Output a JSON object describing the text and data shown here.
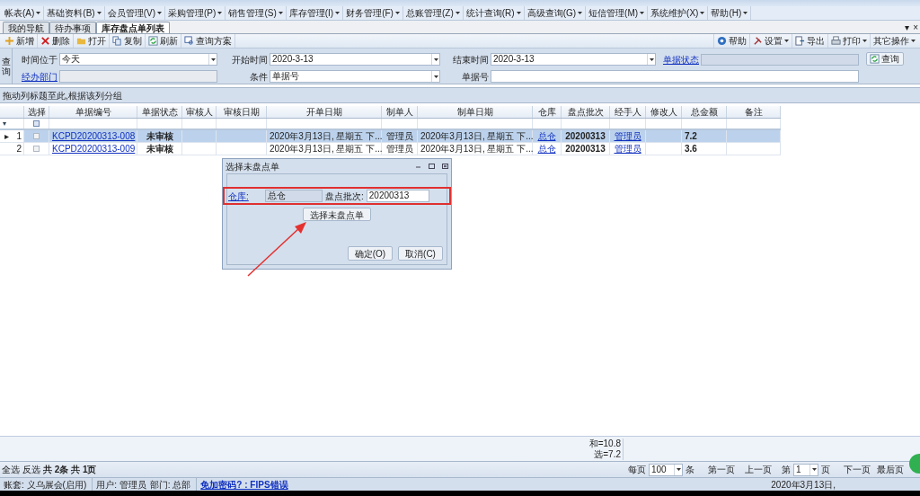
{
  "menu": [
    "帐表(A)",
    "基础资料(B)",
    "会员管理(V)",
    "采购管理(P)",
    "销售管理(S)",
    "库存管理(I)",
    "财务管理(F)",
    "总账管理(Z)",
    "统计查询(R)",
    "高级查询(G)",
    "短信管理(M)",
    "系统维护(X)",
    "帮助(H)"
  ],
  "doc_tabs": [
    {
      "label": "我的导航",
      "selected": false
    },
    {
      "label": "待办事项",
      "selected": false
    },
    {
      "label": "库存盘点单列表",
      "selected": true
    }
  ],
  "tab_controls": [
    "▾",
    "×"
  ],
  "toolbar_left": [
    "新增",
    "删除",
    "打开",
    "复制",
    "刷新",
    "查询方案"
  ],
  "toolbar_right": [
    {
      "label": "帮助",
      "dropdown": false
    },
    {
      "label": "设置",
      "dropdown": true
    },
    {
      "label": "导出",
      "dropdown": false
    },
    {
      "label": "打印",
      "dropdown": true
    },
    {
      "label": "其它操作",
      "dropdown": true
    }
  ],
  "query": {
    "side_label": "查询",
    "time_label": "时间位于",
    "time_value": "今天",
    "start_label": "开始时间",
    "start_value": "2020-3-13",
    "end_label": "结束时间",
    "end_value": "2020-3-13",
    "status_link": "单据状态",
    "dept_link": "经办部门",
    "cond_label": "条件",
    "cond_value": "单据号",
    "no_label": "单据号",
    "search_button": "查询"
  },
  "group_hint": "拖动列标题至此,根据该列分组",
  "table": {
    "columns": [
      "选择",
      "单据编号",
      "单据状态",
      "审核人",
      "审核日期",
      "开单日期",
      "制单人",
      "制单日期",
      "仓库",
      "盘点批次",
      "经手人",
      "修改人",
      "总金额",
      "备注"
    ],
    "filter_row": {
      "checked": false
    },
    "rows": [
      {
        "selected": true,
        "indicator": "▸",
        "number": "1",
        "cells": [
          {
            "kind": "checkbox",
            "checked": false
          },
          {
            "kind": "link",
            "text": "KCPD20200313-008"
          },
          {
            "kind": "text",
            "text": "未审核"
          },
          {
            "kind": "empty"
          },
          {
            "kind": "empty"
          },
          {
            "kind": "text",
            "text": "2020年3月13日, 星期五 下..."
          },
          {
            "kind": "text",
            "text": "管理员"
          },
          {
            "kind": "text",
            "text": "2020年3月13日, 星期五 下..."
          },
          {
            "kind": "link",
            "text": "总仓"
          },
          {
            "kind": "text",
            "text": "20200313"
          },
          {
            "kind": "link",
            "text": "管理员"
          },
          {
            "kind": "empty"
          },
          {
            "kind": "text",
            "text": "7.2"
          },
          {
            "kind": "empty"
          }
        ]
      },
      {
        "selected": false,
        "number": "2",
        "cells": [
          {
            "kind": "checkbox",
            "checked": false
          },
          {
            "kind": "link",
            "text": "KCPD20200313-009"
          },
          {
            "kind": "text",
            "text": "未审核"
          },
          {
            "kind": "empty"
          },
          {
            "kind": "empty"
          },
          {
            "kind": "text",
            "text": "2020年3月13日, 星期五 下..."
          },
          {
            "kind": "text",
            "text": "管理员"
          },
          {
            "kind": "text",
            "text": "2020年3月13日, 星期五 下..."
          },
          {
            "kind": "link",
            "text": "总仓"
          },
          {
            "kind": "text",
            "text": "20200313"
          },
          {
            "kind": "link",
            "text": "管理员"
          },
          {
            "kind": "empty"
          },
          {
            "kind": "text",
            "text": "3.6"
          },
          {
            "kind": "empty"
          }
        ]
      }
    ]
  },
  "dialog": {
    "title": "选择未盘点单",
    "warehouse_link": "仓库:",
    "warehouse_value": "总仓",
    "batch_label": "盘点批次:",
    "batch_value": "20200313",
    "select_button": "选择未盘点单",
    "ok_button": "确定(O)",
    "cancel_button": "取消(C)"
  },
  "summary": [
    "和=10.8",
    "选=7.2"
  ],
  "footer": {
    "select_all": "全选",
    "invert": "反选",
    "count": "共 2条 共 1页",
    "per_page_label": "每页",
    "per_page": "100",
    "unit": "条",
    "first": "第一页",
    "prev": "上一页",
    "page_label": "第",
    "page": "1",
    "page_unit": "页",
    "next": "下一页",
    "last": "最后页"
  },
  "status_bar": {
    "account": "账套: 义乌展会(启用)",
    "user": "用户: 管理员",
    "dept": "部门: 总部",
    "link": "免加密码? : FIPS错误",
    "date": "2020年3月13日,"
  }
}
